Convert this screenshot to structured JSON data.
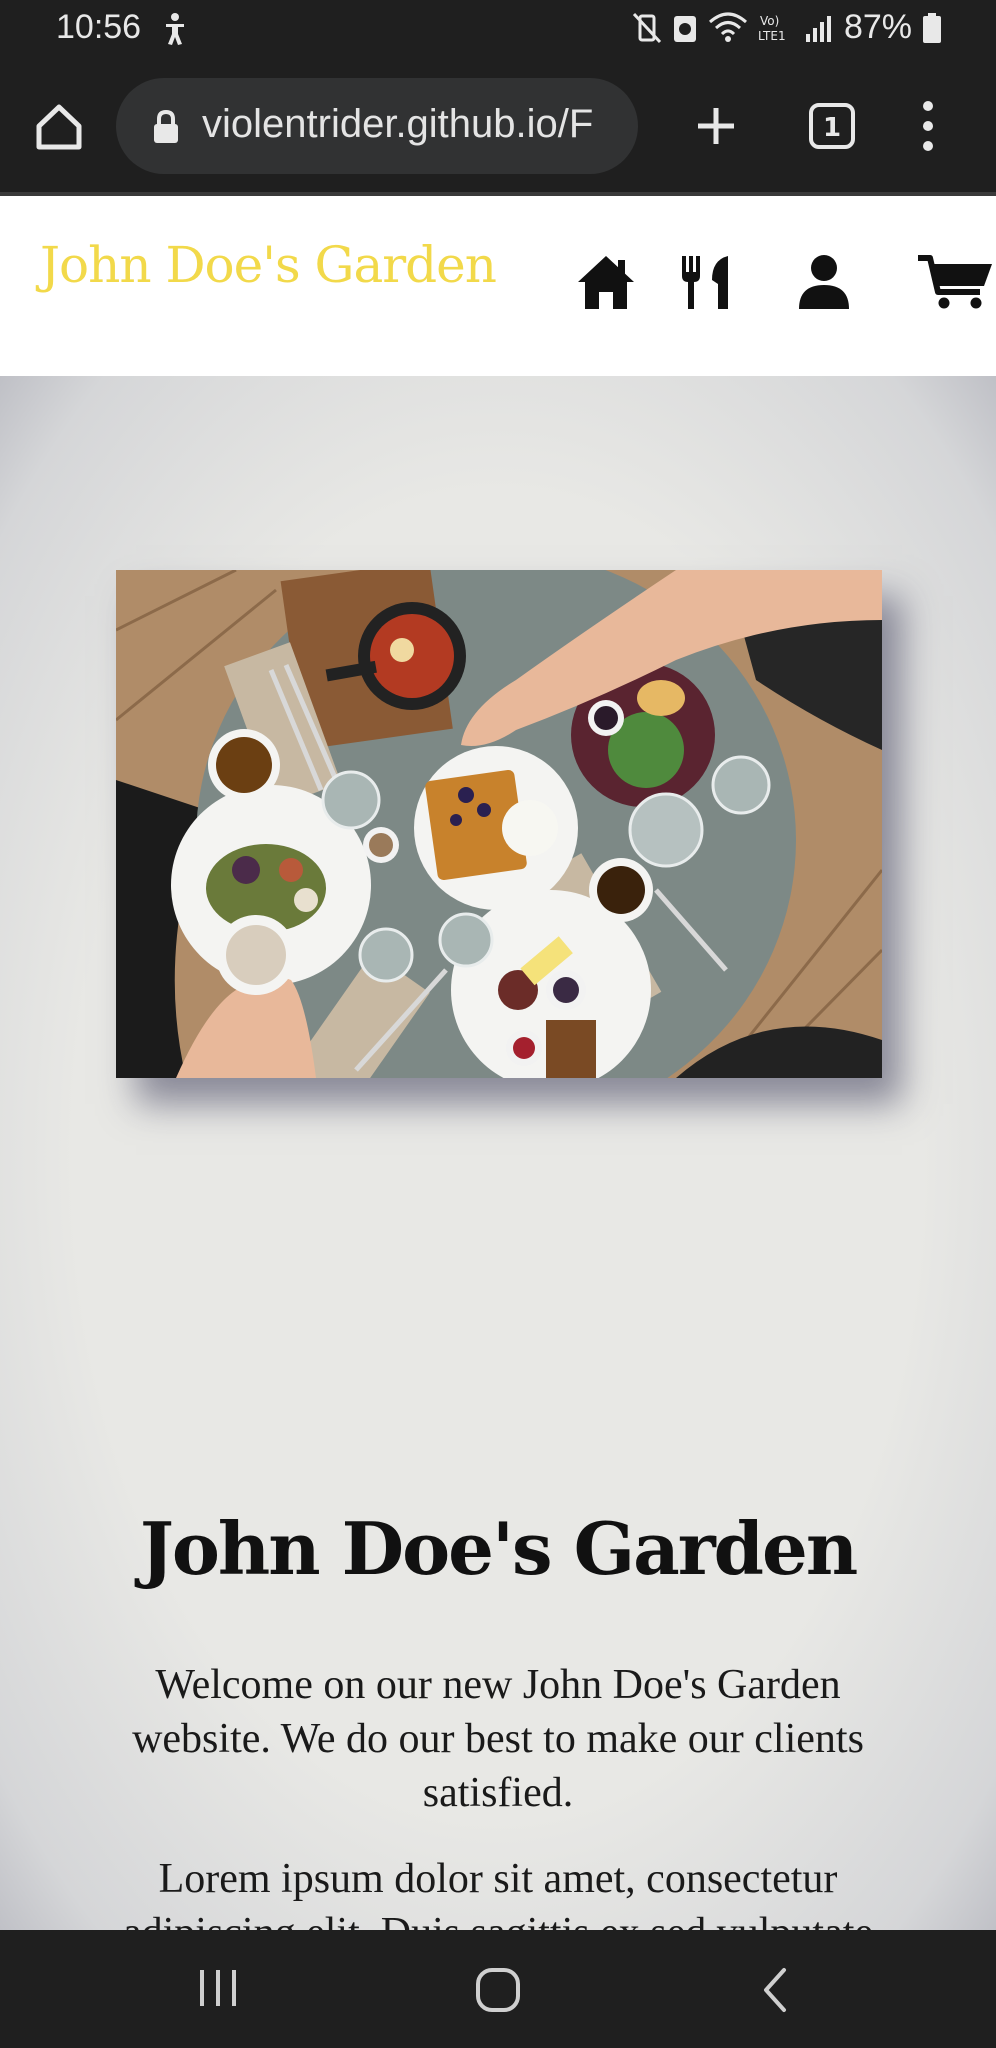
{
  "status_bar": {
    "time": "10:56",
    "battery": "87%",
    "icons": [
      "accessibility-icon",
      "mute-vibrate-icon",
      "eco-icon",
      "wifi-icon",
      "volte-icon",
      "signal-icon",
      "battery-icon"
    ]
  },
  "browser": {
    "url": "violentrider.github.io/F",
    "tab_count": "1",
    "icons": [
      "home-icon",
      "lock-icon",
      "plus-icon",
      "tabs-icon",
      "more-vertical-icon"
    ]
  },
  "site": {
    "logo": "John Doe's Garden",
    "nav_icons": [
      "home-icon",
      "restaurant-icon",
      "user-icon",
      "cart-icon"
    ],
    "hero": {
      "image_alt": "",
      "title": "John Doe's Garden",
      "paragraph1": "Welcome on our new John Doe's Garden website. We do our best to make our clients satisfied.",
      "paragraph2": "Lorem ipsum dolor sit amet, consectetur adipiscing elit. Duis sagittis ex sed vulputate molestie. Cras felis arcu, consequat eget rutrum at, tempor sed erat. Vivamus ultricies egestas urna sed"
    }
  },
  "android_nav": {
    "icons": [
      "recent-apps-icon",
      "home-button-icon",
      "back-icon"
    ]
  },
  "colors": {
    "logo": "#f2d94a",
    "system_bars": "#1f1f1f",
    "url_pill": "#313233",
    "page_bg": "#e6e6e3"
  }
}
